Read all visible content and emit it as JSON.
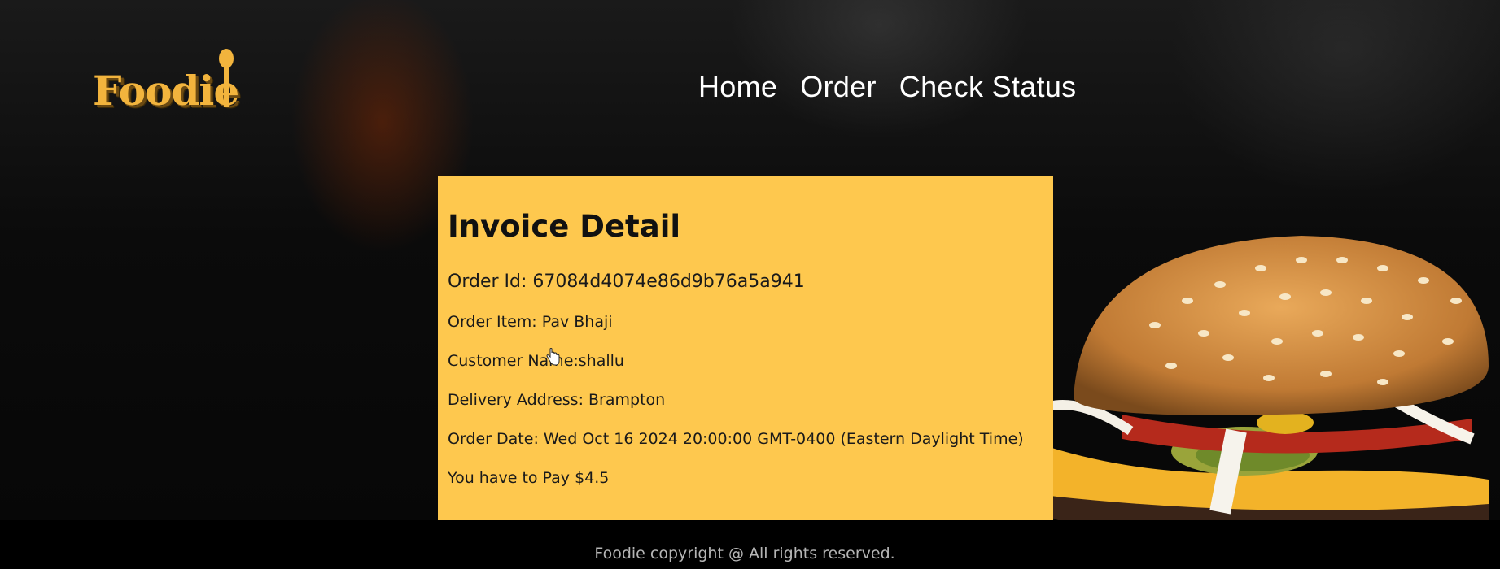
{
  "brand": {
    "logo_text": "Foodie"
  },
  "nav": {
    "items": [
      {
        "label": "Home"
      },
      {
        "label": "Order"
      },
      {
        "label": "Check Status"
      }
    ]
  },
  "invoice": {
    "title": "Invoice Detail",
    "order_id": "Order Id: 67084d4074e86d9b76a5a941",
    "order_item": "Order Item: Pav Bhaji",
    "customer_name": "Customer Name:shallu",
    "delivery_address": "Delivery Address: Brampton",
    "order_date": "Order Date: Wed Oct 16 2024 20:00:00 GMT-0400 (Eastern Daylight Time)",
    "payment": "You have to Pay $4.5"
  },
  "footer": {
    "copyright": "Foodie copyright @ All rights reserved."
  },
  "colors": {
    "accent": "#fec84e",
    "logo": "#f2b43d",
    "background": "#000000"
  }
}
